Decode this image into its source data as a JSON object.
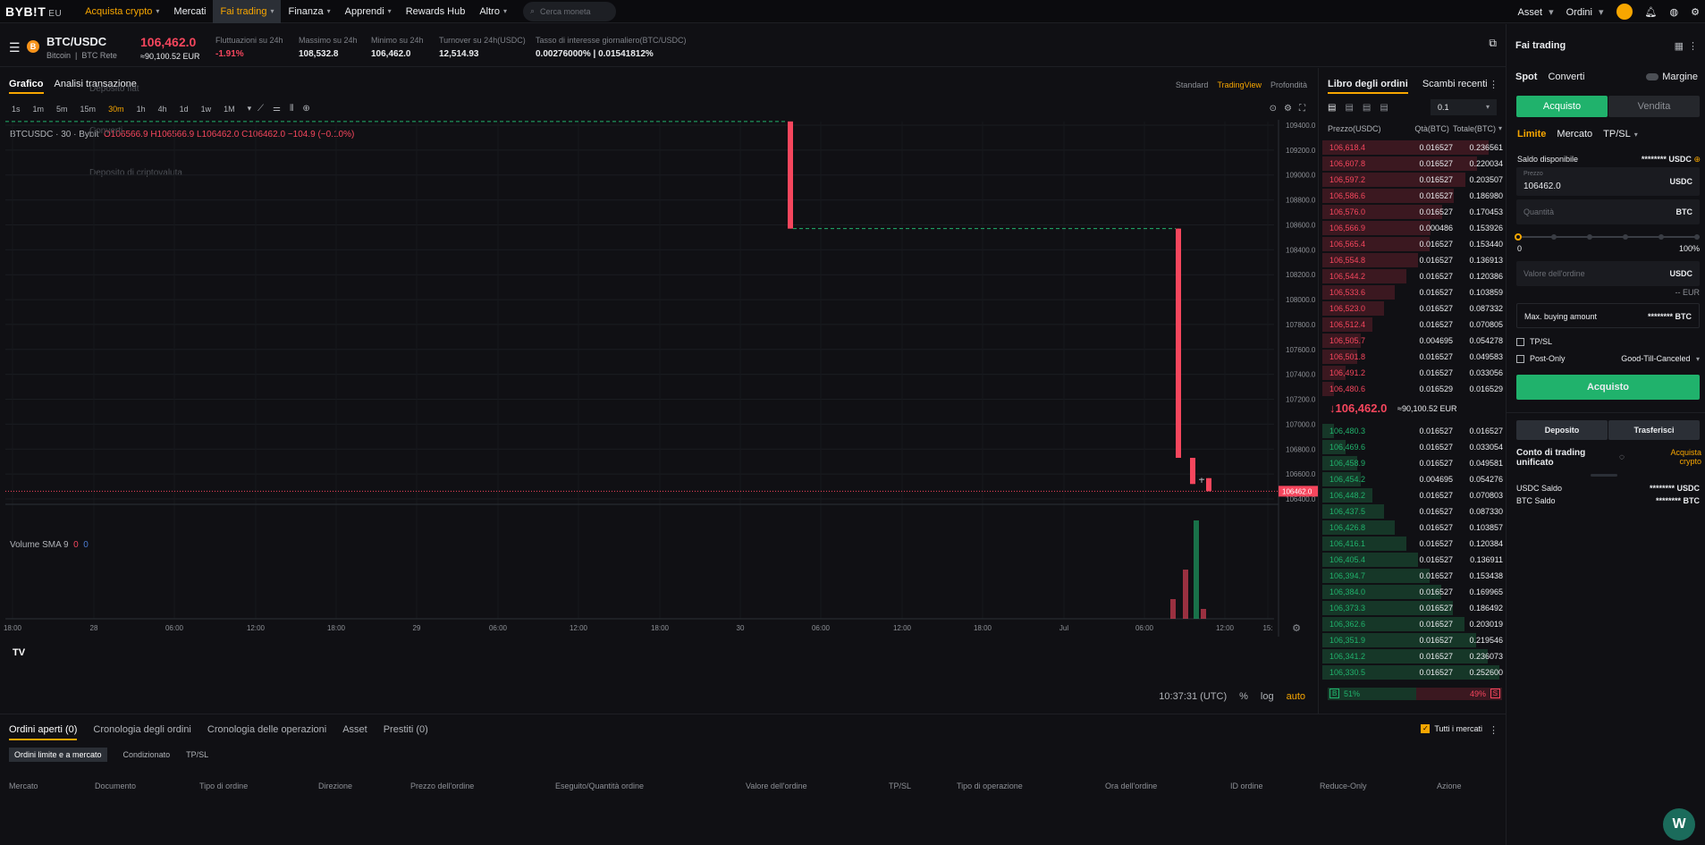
{
  "nav": {
    "logo": "BYB!T",
    "logo_suffix": "EU",
    "items": [
      {
        "label": "Acquista crypto",
        "caret": true,
        "style": "acc"
      },
      {
        "label": "Mercati",
        "caret": false,
        "style": ""
      },
      {
        "label": "Fai trading",
        "caret": true,
        "style": "active"
      },
      {
        "label": "Finanza",
        "caret": true,
        "style": ""
      },
      {
        "label": "Apprendi",
        "caret": true,
        "style": ""
      },
      {
        "label": "Rewards Hub",
        "caret": false,
        "style": ""
      },
      {
        "label": "Altro",
        "caret": true,
        "style": ""
      }
    ],
    "search_placeholder": "Cerca moneta",
    "asset": "Asset",
    "orders": "Ordini"
  },
  "ticker": {
    "pair": "BTC/USDC",
    "coin_icon": "B",
    "sub1": "Bitcoin",
    "sub2": "BTC Rete",
    "price": "106,462.0",
    "price_eur": "≈90,100.52 EUR",
    "stats": [
      {
        "label": "Fluttuazioni su 24h",
        "value": "-1.91%",
        "color": "#f6465d"
      },
      {
        "label": "Massimo su 24h",
        "value": "108,532.8",
        "color": "#eaecef"
      },
      {
        "label": "Minimo su 24h",
        "value": "106,462.0",
        "color": "#eaecef"
      },
      {
        "label": "Turnover su 24h(USDC)",
        "value": "12,514.93",
        "color": "#eaecef"
      },
      {
        "label": "Tasso di interesse giornaliero(BTC/USDC)",
        "value": "0.00276000% | 0.01541812%",
        "color": "#eaecef"
      }
    ]
  },
  "chart_panel": {
    "tabs": [
      "Grafico",
      "Analisi transazione"
    ],
    "views": [
      "Standard",
      "TradingView",
      "Profondità"
    ],
    "timeframes": [
      "1s",
      "1m",
      "5m",
      "15m",
      "30m",
      "1h",
      "4h",
      "1d",
      "1w",
      "1M"
    ],
    "active_tf": "30m",
    "ohlc_symbol": "BTCUSDC · 30 · Bybit",
    "ohlc_o": "O106566.9",
    "ohlc_h": "H106566.9",
    "ohlc_l": "L106462.0",
    "ohlc_c": "C106462.0",
    "ohlc_chg": "−104.9 (−0.10%)",
    "volume_label": "Volume SMA 9",
    "vol_v1": "0",
    "vol_v2": "0",
    "time": "10:37:31 (UTC)",
    "opt_pct": "%",
    "opt_log": "log",
    "opt_auto": "auto",
    "tv_logo": "TV",
    "ghost_menu": [
      "Deposito fiat",
      "Converti",
      "Deposito di criptovaluta"
    ],
    "price_tag": "106462.0"
  },
  "chart_data": {
    "type": "candlestick",
    "y_ticks": [
      "109400.0",
      "109200.0",
      "109000.0",
      "108800.0",
      "108600.0",
      "108400.0",
      "108200.0",
      "108000.0",
      "107800.0",
      "107600.0",
      "107400.0",
      "107200.0",
      "107000.0",
      "106800.0",
      "106600.0",
      "106400.0"
    ],
    "ylim": [
      106400,
      109400
    ],
    "x_ticks": [
      "18:00",
      "28",
      "06:00",
      "12:00",
      "18:00",
      "29",
      "06:00",
      "12:00",
      "18:00",
      "30",
      "06:00",
      "12:00",
      "18:00",
      "Jul",
      "06:00",
      "12:00",
      "15:"
    ],
    "candles": [
      {
        "o": 109430,
        "h": 109430,
        "l": 108570,
        "c": 108570,
        "color": "#f6465d"
      },
      {
        "o": 108570,
        "h": 108570,
        "l": 106730,
        "c": 106730,
        "color": "#f6465d"
      },
      {
        "o": 106730,
        "h": 106730,
        "l": 106520,
        "c": 106520,
        "color": "#f6465d"
      },
      {
        "o": 106560,
        "h": 106570,
        "l": 106530,
        "c": 106560,
        "color": "#b0b3b8"
      },
      {
        "o": 106566.9,
        "h": 106566.9,
        "l": 106462,
        "c": 106462,
        "color": "#f6465d"
      }
    ],
    "volume_bars": [
      {
        "value": 0.2,
        "color": "#f6465d"
      },
      {
        "value": 0.5,
        "color": "#f6465d"
      },
      {
        "value": 1.0,
        "color": "#20b26c"
      },
      {
        "value": 0.1,
        "color": "#f6465d"
      }
    ]
  },
  "orderbook": {
    "tabs": [
      "Libro degli ordini",
      "Scambi recenti"
    ],
    "precision": "0.1",
    "headers": [
      "Prezzo(USDC)",
      "Qtà(BTC)",
      "Totale(BTC)"
    ],
    "asks": [
      [
        "106,618.4",
        "0.016527",
        "0.236561"
      ],
      [
        "106,607.8",
        "0.016527",
        "0.220034"
      ],
      [
        "106,597.2",
        "0.016527",
        "0.203507"
      ],
      [
        "106,586.6",
        "0.016527",
        "0.186980"
      ],
      [
        "106,576.0",
        "0.016527",
        "0.170453"
      ],
      [
        "106,566.9",
        "0.000486",
        "0.153926"
      ],
      [
        "106,565.4",
        "0.016527",
        "0.153440"
      ],
      [
        "106,554.8",
        "0.016527",
        "0.136913"
      ],
      [
        "106,544.2",
        "0.016527",
        "0.120386"
      ],
      [
        "106,533.6",
        "0.016527",
        "0.103859"
      ],
      [
        "106,523.0",
        "0.016527",
        "0.087332"
      ],
      [
        "106,512.4",
        "0.016527",
        "0.070805"
      ],
      [
        "106,505.7",
        "0.004695",
        "0.054278"
      ],
      [
        "106,501.8",
        "0.016527",
        "0.049583"
      ],
      [
        "106,491.2",
        "0.016527",
        "0.033056"
      ],
      [
        "106,480.6",
        "0.016529",
        "0.016529"
      ]
    ],
    "mid_price": "↓106,462.0",
    "mid_eur": "≈90,100.52 EUR",
    "bids": [
      [
        "106,480.3",
        "0.016527",
        "0.016527"
      ],
      [
        "106,469.6",
        "0.016527",
        "0.033054"
      ],
      [
        "106,458.9",
        "0.016527",
        "0.049581"
      ],
      [
        "106,454.2",
        "0.004695",
        "0.054276"
      ],
      [
        "106,448.2",
        "0.016527",
        "0.070803"
      ],
      [
        "106,437.5",
        "0.016527",
        "0.087330"
      ],
      [
        "106,426.8",
        "0.016527",
        "0.103857"
      ],
      [
        "106,416.1",
        "0.016527",
        "0.120384"
      ],
      [
        "106,405.4",
        "0.016527",
        "0.136911"
      ],
      [
        "106,394.7",
        "0.016527",
        "0.153438"
      ],
      [
        "106,384.0",
        "0.016527",
        "0.169965"
      ],
      [
        "106,373.3",
        "0.016527",
        "0.186492"
      ],
      [
        "106,362.6",
        "0.016527",
        "0.203019"
      ],
      [
        "106,351.9",
        "0.016527",
        "0.219546"
      ],
      [
        "106,341.2",
        "0.016527",
        "0.236073"
      ],
      [
        "106,330.5",
        "0.016527",
        "0.252600"
      ]
    ],
    "buy_label": "B",
    "buy_pct": "51%",
    "sell_pct": "49%",
    "sell_label": "S",
    "buy_ratio": 0.51
  },
  "trade": {
    "title": "Fai trading",
    "segments": [
      "Spot",
      "Converti"
    ],
    "margin": "Margine",
    "buy": "Acquisto",
    "sell": "Vendita",
    "order_types": [
      "Limite",
      "Mercato",
      "TP/SL"
    ],
    "available_label": "Saldo disponibile",
    "available_value": "******** USDC",
    "price_label": "Prezzo",
    "price_value": "106462.0",
    "price_unit": "USDC",
    "qty_placeholder": "Quantità",
    "qty_unit": "BTC",
    "slider_min": "0",
    "slider_max": "100%",
    "order_value_placeholder": "Valore dell'ordine",
    "order_value_unit": "USDC",
    "eur_hint": "-- EUR",
    "max_buy_label": "Max. buying amount",
    "max_buy_value": "******** BTC",
    "tpsl": "TP/SL",
    "post_only": "Post-Only",
    "tif": "Good-Till-Canceled",
    "submit": "Acquisto",
    "deposit": "Deposito",
    "transfer": "Trasferisci",
    "account_title": "Conto di trading unificato",
    "account_buy": "Acquista crypto",
    "usdc_label": "USDC Saldo",
    "usdc_value": "******** USDC",
    "btc_label": "BTC Saldo",
    "btc_value": "******** BTC"
  },
  "bottom": {
    "tabs": [
      "Ordini aperti (0)",
      "Cronologia degli ordini",
      "Cronologia delle operazioni",
      "Asset",
      "Prestiti (0)"
    ],
    "subtabs": [
      "Ordini limite e a mercato",
      "Condizionato",
      "TP/SL"
    ],
    "all_markets": "Tutti i mercati",
    "columns": [
      "Mercato",
      "Documento",
      "Tipo di ordine",
      "Direzione",
      "Prezzo dell'ordine",
      "Eseguito/Quantità ordine",
      "Valore dell'ordine",
      "TP/SL",
      "Tipo di operazione",
      "Ora dell'ordine",
      "ID ordine",
      "Reduce-Only",
      "Azione"
    ]
  }
}
